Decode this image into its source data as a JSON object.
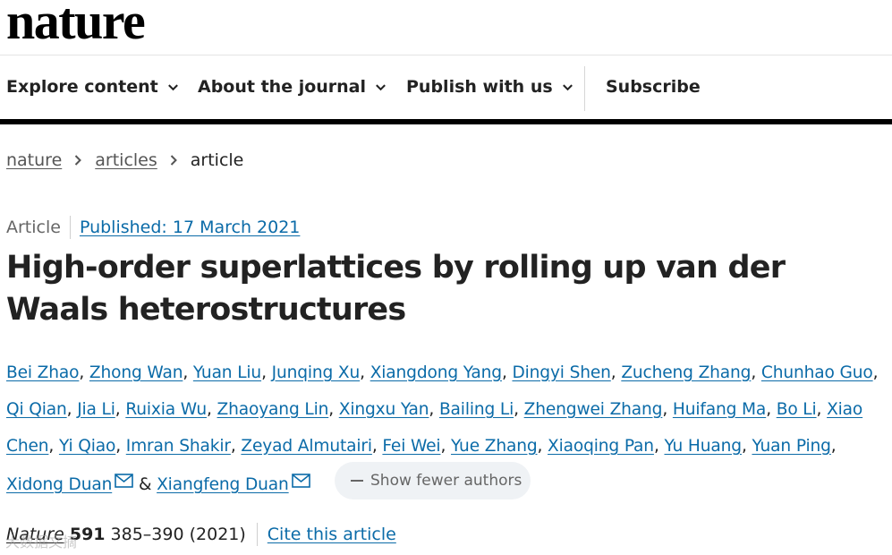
{
  "masthead": {
    "logo_text": "nature"
  },
  "nav": {
    "items": [
      {
        "label": "Explore content"
      },
      {
        "label": "About the journal"
      },
      {
        "label": "Publish with us"
      }
    ],
    "subscribe_label": "Subscribe"
  },
  "breadcrumb": {
    "items": [
      {
        "label": "nature"
      },
      {
        "label": "articles"
      }
    ],
    "current": "article"
  },
  "article": {
    "type": "Article",
    "published": "Published: 17 March 2021",
    "title": "High-order superlattices by rolling up van der Waals heterostructures",
    "authors": [
      "Bei Zhao",
      "Zhong Wan",
      "Yuan Liu",
      "Junqing Xu",
      "Xiangdong Yang",
      "Dingyi Shen",
      "Zucheng Zhang",
      "Chunhao Guo",
      "Qi Qian",
      "Jia Li",
      "Ruixia Wu",
      "Zhaoyang Lin",
      "Xingxu Yan",
      "Bailing Li",
      "Zhengwei Zhang",
      "Huifang Ma",
      "Bo Li",
      "Xiao Chen",
      "Yi Qiao",
      "Imran Shakir",
      "Zeyad Almutairi",
      "Fei Wei",
      "Yue Zhang",
      "Xiaoqing Pan",
      "Yu Huang",
      "Yuan Ping",
      "Xidong Duan",
      "Xiangfeng Duan"
    ],
    "author_separator": ", ",
    "author_final_joiner": " & ",
    "corresponding_icon": "mail-icon",
    "show_fewer_label": "Show fewer authors"
  },
  "citation": {
    "journal": "Nature",
    "volume": "591",
    "pages_year": "385–390 (2021)",
    "cite_label": "Cite this article"
  },
  "watermark": {
    "text": "大数据文摘"
  },
  "colors": {
    "link": "#0b6ba8",
    "text": "#222222",
    "muted": "#666666",
    "pill_bg": "#eff2f5"
  }
}
